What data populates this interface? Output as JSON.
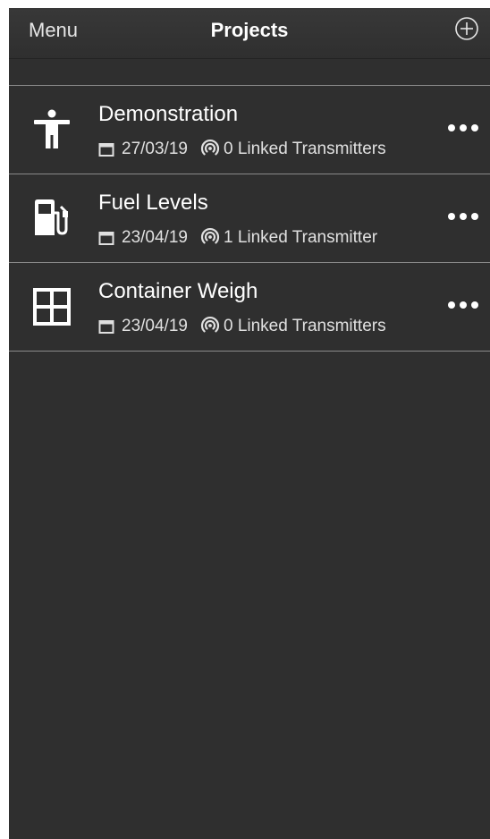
{
  "navbar": {
    "menu_label": "Menu",
    "title": "Projects",
    "add_icon": "plus-circle-icon"
  },
  "projects": [
    {
      "icon": "person-icon",
      "name": "Demonstration",
      "date": "27/03/19",
      "transmitters": "0 Linked Transmitters"
    },
    {
      "icon": "fuel-pump-icon",
      "name": "Fuel Levels",
      "date": "23/04/19",
      "transmitters": "1 Linked Transmitter"
    },
    {
      "icon": "grid-icon",
      "name": "Container Weigh",
      "date": "23/04/19",
      "transmitters": "0 Linked Transmitters"
    }
  ],
  "colors": {
    "background": "#2f2f2f",
    "separator": "#8a8a8a",
    "text": "#ffffff"
  }
}
